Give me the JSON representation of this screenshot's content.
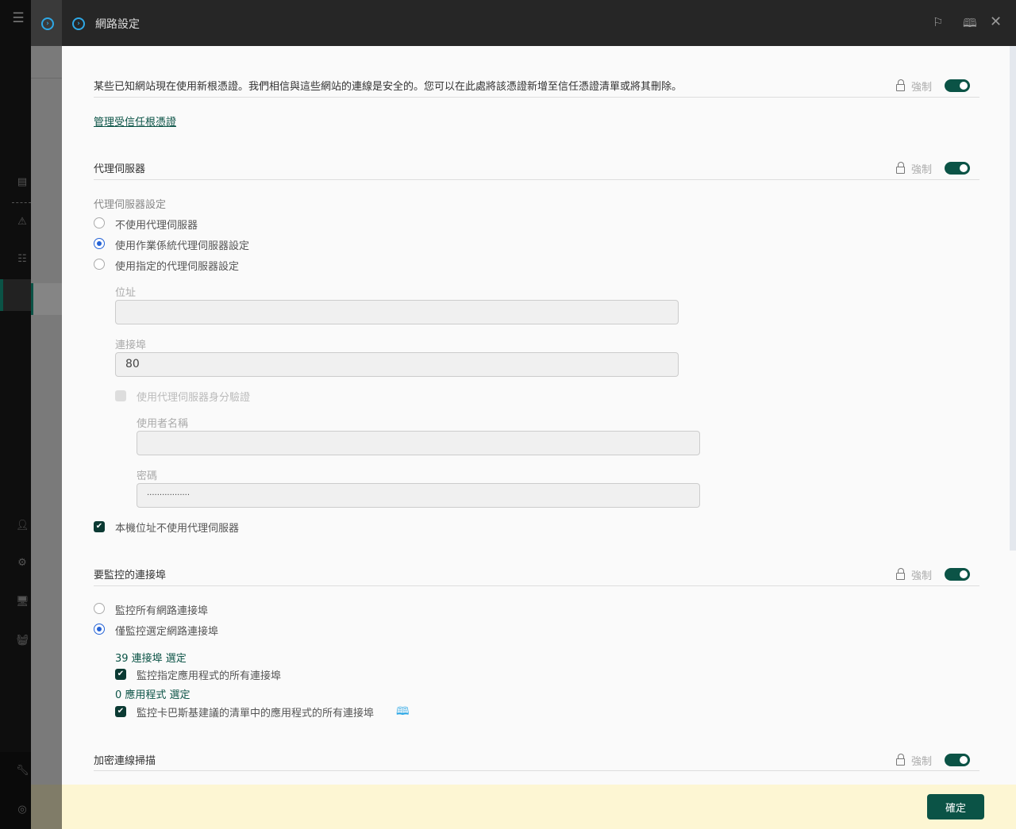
{
  "header": {
    "title": "網路設定"
  },
  "cert": {
    "text": "某些已知網站現在使用新根憑證。我們相信與這些網站的連線是安全的。您可以在此處將該憑證新增至信任憑證清單或將其刪除。",
    "link": "管理受信任根憑證"
  },
  "enforce_label": "強制",
  "proxy": {
    "title": "代理伺服器",
    "settings_label": "代理伺服器設定",
    "options": [
      "不使用代理伺服器",
      "使用作業係統代理伺服器設定",
      "使用指定的代理伺服器設定"
    ],
    "selected": 1,
    "address_label": "位址",
    "address_value": "",
    "port_label": "連接埠",
    "port_value": "80",
    "auth_label": "使用代理伺服器身分驗證",
    "username_label": "使用者名稱",
    "username_value": "",
    "password_label": "密碼",
    "password_value": "·················",
    "bypass_local_label": "本機位址不使用代理伺服器"
  },
  "ports": {
    "title": "要監控的連接埠",
    "options": [
      "監控所有網路連接埠",
      "僅監控選定網路連接埠"
    ],
    "selected": 1,
    "ports_selected_link": "39 連接埠 選定",
    "monitor_apps_label": "監控指定應用程式的所有連接埠",
    "apps_selected_link": "0 應用程式 選定",
    "monitor_kaspersky_label": "監控卡巴斯基建議的清單中的應用程式的所有連接埠"
  },
  "encrypted": {
    "title": "加密連線掃描"
  },
  "footer": {
    "ok_label": "確定"
  }
}
